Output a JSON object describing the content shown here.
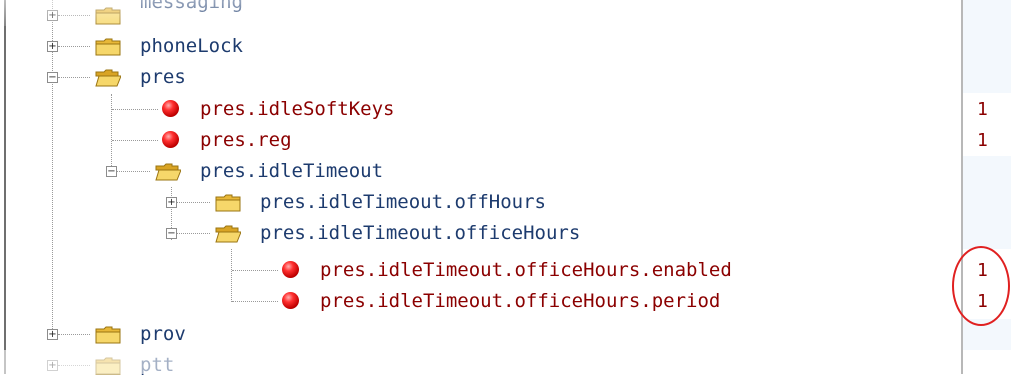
{
  "tree": {
    "rows": [
      {
        "label": "messaging",
        "kind": "folder",
        "expander": "+",
        "value": ""
      },
      {
        "label": "phoneLock",
        "kind": "folder",
        "expander": "+",
        "value": ""
      },
      {
        "label": "pres",
        "kind": "folder",
        "expander": "−",
        "value": ""
      },
      {
        "label": "pres.idleSoftKeys",
        "kind": "leaf",
        "expander": "",
        "value": "1"
      },
      {
        "label": "pres.reg",
        "kind": "leaf",
        "expander": "",
        "value": "1"
      },
      {
        "label": "pres.idleTimeout",
        "kind": "folder",
        "expander": "−",
        "value": ""
      },
      {
        "label": "pres.idleTimeout.offHours",
        "kind": "folder",
        "expander": "+",
        "value": ""
      },
      {
        "label": "pres.idleTimeout.officeHours",
        "kind": "folder",
        "expander": "−",
        "value": ""
      },
      {
        "label": "pres.idleTimeout.officeHours.enabled",
        "kind": "leaf",
        "expander": "",
        "value": "1"
      },
      {
        "label": "pres.idleTimeout.officeHours.period",
        "kind": "leaf",
        "expander": "",
        "value": "1"
      },
      {
        "label": "prov",
        "kind": "folder",
        "expander": "+",
        "value": ""
      },
      {
        "label": "ptt",
        "kind": "folder",
        "expander": "+",
        "value": ""
      }
    ]
  },
  "colors": {
    "folder_label": "#1d3b6e",
    "leaf_label": "#8b0000",
    "value_text": "#8b0000",
    "annotation_circle": "#e02020",
    "value_band": "#f3f8fd"
  },
  "icons": {
    "folder": "folder-icon",
    "leaf": "red-ball-icon",
    "expand": "plus-expander-icon",
    "collapse": "minus-expander-icon"
  }
}
